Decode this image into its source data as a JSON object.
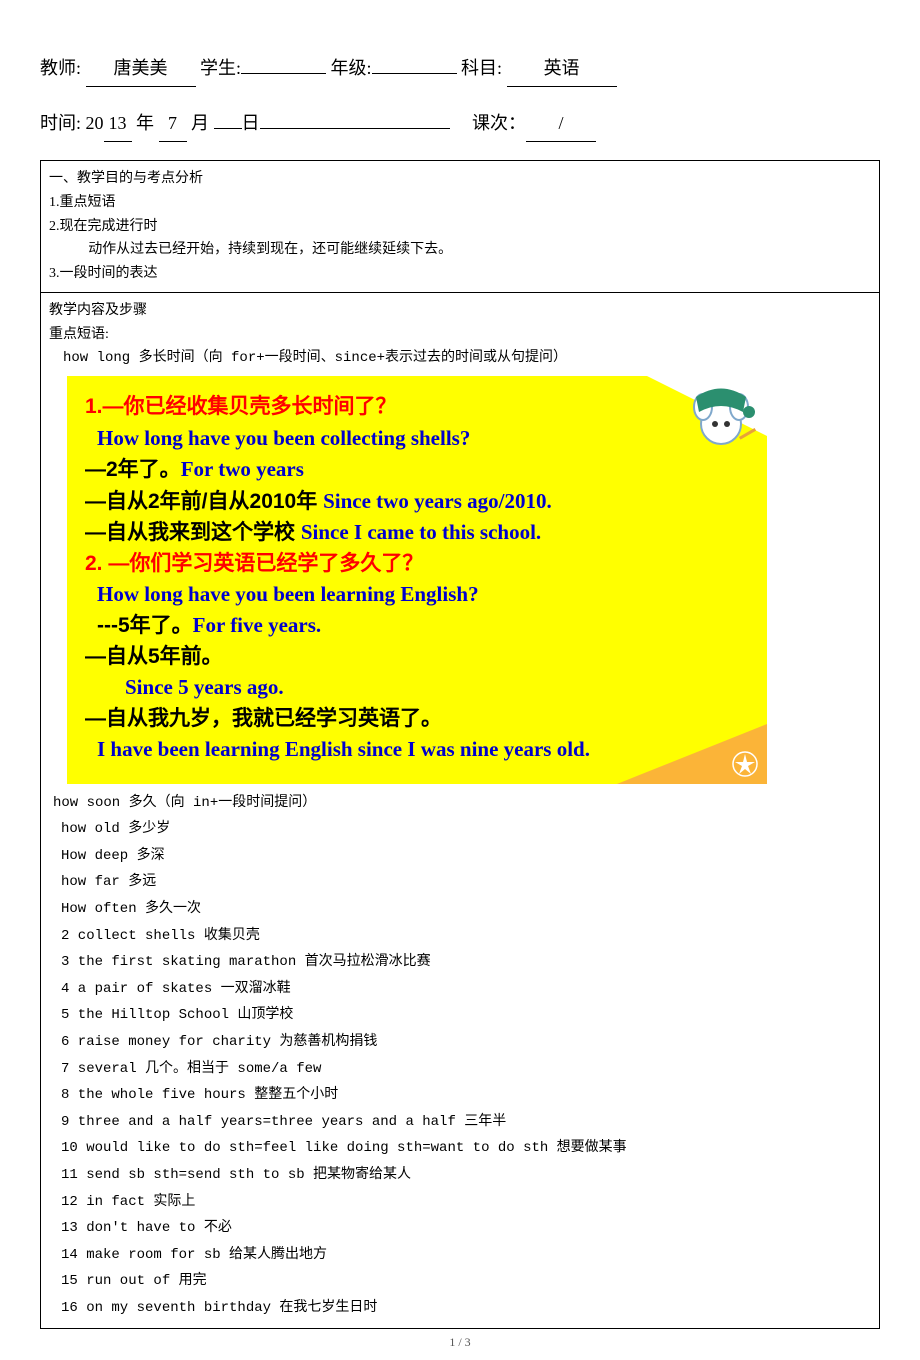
{
  "header": {
    "teacher_label": "教师: ",
    "teacher_value": "唐美美",
    "student_label": " 学生:",
    "grade_label": " 年级:",
    "subject_label": " 科目: ",
    "subject_value": "英语",
    "time_label": "时间: 20",
    "year_value": "13",
    "year_suffix": " 年 ",
    "month_value": "7",
    "month_suffix": " 月 ",
    "day_suffix": "日",
    "session_label": " 课次：",
    "session_value": "/"
  },
  "section1": {
    "title": "一、教学目的与考点分析",
    "item1": "1.重点短语",
    "item2": "2.现在完成进行时",
    "item2_sub": "动作从过去已经开始，持续到现在，还可能继续延续下去。",
    "item3": "3.一段时间的表达"
  },
  "section2": {
    "title": "教学内容及步骤",
    "subtitle": "重点短语:",
    "howlong": "how long 多长时间（向 for+一段时间、since+表示过去的时间或从句提问）"
  },
  "slide": {
    "l1_num": "1.",
    "l1_zh": "—你已经收集贝壳多长时间了？",
    "l2_en": "How long have you been collecting shells?",
    "l3_zh": "—2年了。",
    "l3_en": "For two years",
    "l4_zh": "—自从2年前/自从2010年 ",
    "l4_en": "Since two years ago/2010.",
    "l5_zh": "—自从我来到这个学校 ",
    "l5_en": "Since I came to this school.",
    "l6_num": "2. ",
    "l6_zh": "—你们学习英语已经学了多久了？",
    "l7_en": "How long have you been learning English?",
    "l8_zh": "---5年了。",
    "l8_en": "For five years.",
    "l9_zh": "—自从5年前。",
    "l10_en": "Since 5 years ago.",
    "l11_zh": "—自从我九岁，我就已经学习英语了。",
    "l12_en": "I have been learning English since I was nine years old."
  },
  "phrases": [
    "how  soon 多久（向 in+一段时间提问）",
    "how  old 多少岁",
    "How deep 多深",
    " how far 多远",
    "How often 多久一次",
    "2 collect shells 收集贝壳",
    "3 the first skating marathon 首次马拉松滑冰比赛",
    "4 a pair of skates 一双溜冰鞋",
    "5 the Hilltop School 山顶学校",
    "6 raise money for charity 为慈善机构捐钱",
    "7 several 几个。相当于 some/a few",
    "8 the whole five hours 整整五个小时",
    "9 three and a half years=three years and a half 三年半",
    "10 would like to do sth=feel like doing sth=want to do sth 想要做某事",
    "11 send sb sth=send sth to sb 把某物寄给某人",
    "12 in fact 实际上",
    "13 don't have to 不必",
    "14 make room for sb 给某人腾出地方",
    "15 run out of 用完",
    "16 on my seventh birthday 在我七岁生日时"
  ],
  "footer": "1 / 3"
}
